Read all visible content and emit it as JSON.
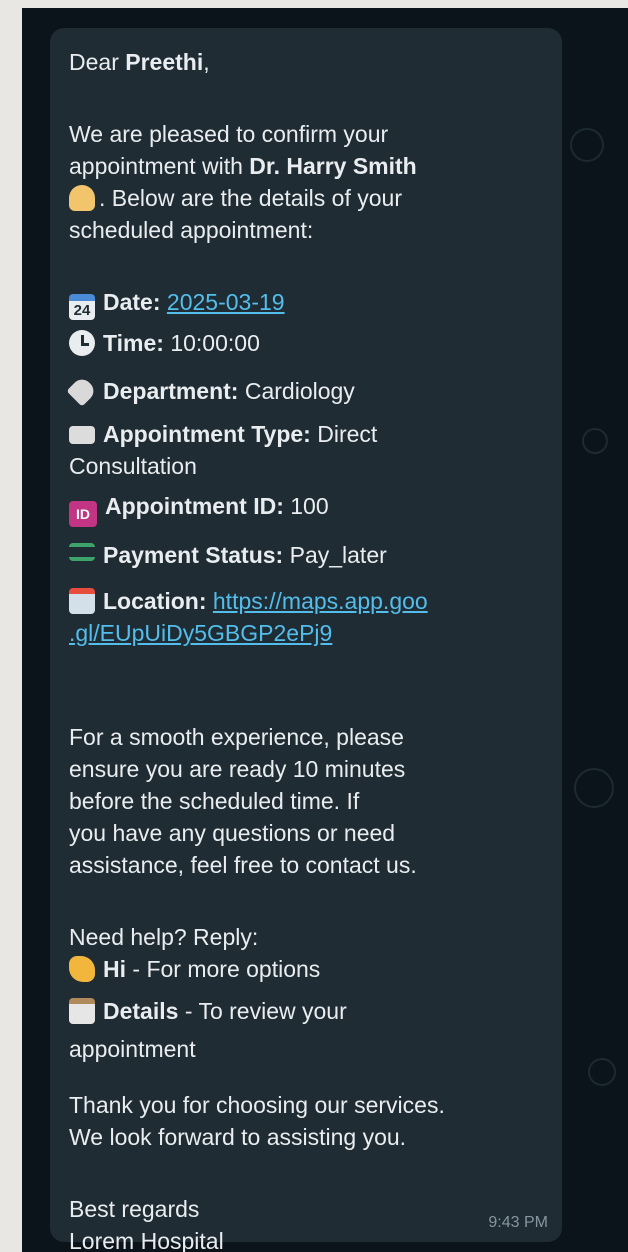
{
  "message": {
    "greeting_prefix": "Dear ",
    "greeting_name": "Preethi",
    "greeting_suffix": ",",
    "intro_1": "We are pleased to confirm your",
    "intro_2_prefix": "appointment with ",
    "doctor": "Dr. Harry Smith",
    "intro_3": ". Below are the details of your",
    "intro_4": "scheduled appointment:",
    "details": {
      "date_label": "Date:",
      "date_value": "2025-03-19",
      "time_label": "Time:",
      "time_value": " 10:00:00",
      "department_label": "Department:",
      "department_value": " Cardiology",
      "type_label": "Appointment Type:",
      "type_value": " Direct",
      "type_value_cont": "Consultation",
      "id_label": "Appointment ID:",
      "id_value": " 100",
      "payment_label": "Payment Status:",
      "payment_value": " Pay_later",
      "location_label": "Location:",
      "location_link_1": "https://maps.app.goo",
      "location_link_2": ".gl/EUpUiDy5GBGP2ePj9"
    },
    "calendar_icon_text": "24",
    "id_icon_text": "ID",
    "para_1": "For a smooth experience, please",
    "para_2": "ensure you are ready 10 minutes",
    "para_3": "before the scheduled time. If",
    "para_4": "you have any questions or need",
    "para_5": "assistance, feel free to contact us.",
    "help_title": "Need help? Reply:",
    "hi_label": "Hi",
    "hi_desc": " - For more options",
    "details_label": "Details",
    "details_desc": " - To review your",
    "details_desc_cont": "appointment",
    "thanks_1": "Thank you for choosing our services.",
    "thanks_2": "We look forward to assisting you.",
    "closing_1": "Best regards",
    "closing_2": "Lorem Hospital",
    "timestamp": "9:43 PM"
  },
  "icons": {
    "doctor": "doctor-emoji-icon",
    "calendar": "calendar-icon",
    "time": "clock-icon",
    "department": "label-tag-icon",
    "type": "open-book-icon",
    "id": "id-icon",
    "payment": "banknote-icon",
    "location": "hospital-icon",
    "hi": "waving-hand-icon",
    "details": "clipboard-icon"
  },
  "colors": {
    "bubble_bg": "#1f2c34",
    "chat_bg": "#0b141a",
    "text": "#e9edef",
    "link": "#53bdeb",
    "timestamp": "#8696a0"
  }
}
